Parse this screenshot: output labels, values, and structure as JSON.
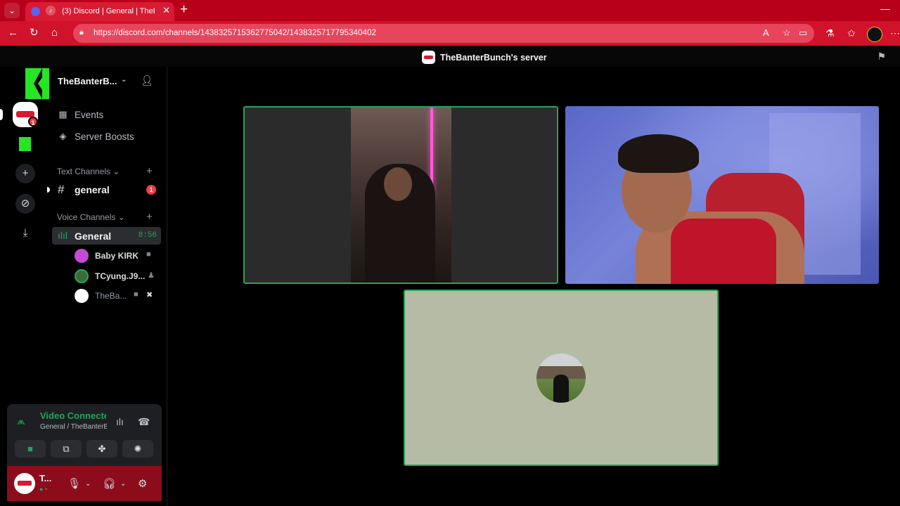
{
  "browser": {
    "tab_title": "(3) Discord | General | TheBa",
    "url": "https://discord.com/channels/1438325715362775042/1438325717795340402",
    "colors": {
      "tabbar": "#b8001a",
      "addressbar": "#d1122b"
    }
  },
  "discord": {
    "server_title": "TheBanterBunch's server",
    "guild_name": "TheBanterB...",
    "overlay_number": "1",
    "rail_badge": "1",
    "menu": {
      "events": "Events",
      "server_boosts": "Server Boosts"
    },
    "text_category": "Text Channels",
    "text_channel": {
      "name": "general",
      "mentions": "1"
    },
    "voice_category": "Voice Channels",
    "voice_channel": {
      "name": "General",
      "elapsed": "8:56"
    },
    "members": [
      {
        "name": "Baby KIRK",
        "avatar_color": "#c54bd6"
      },
      {
        "name": "TCyung.J9...",
        "avatar_color": "#3b6b3b"
      },
      {
        "name": "TheBa...",
        "avatar_color": "#ffffff"
      }
    ],
    "voice_panel": {
      "status": "Video Connected",
      "location": "General / TheBanterBunch's server"
    },
    "user_panel": {
      "name": "T...",
      "status": "● •"
    },
    "accent_colors": {
      "green": "#23a55a",
      "red": "#f23f43",
      "blurple": "#5865f2"
    }
  }
}
